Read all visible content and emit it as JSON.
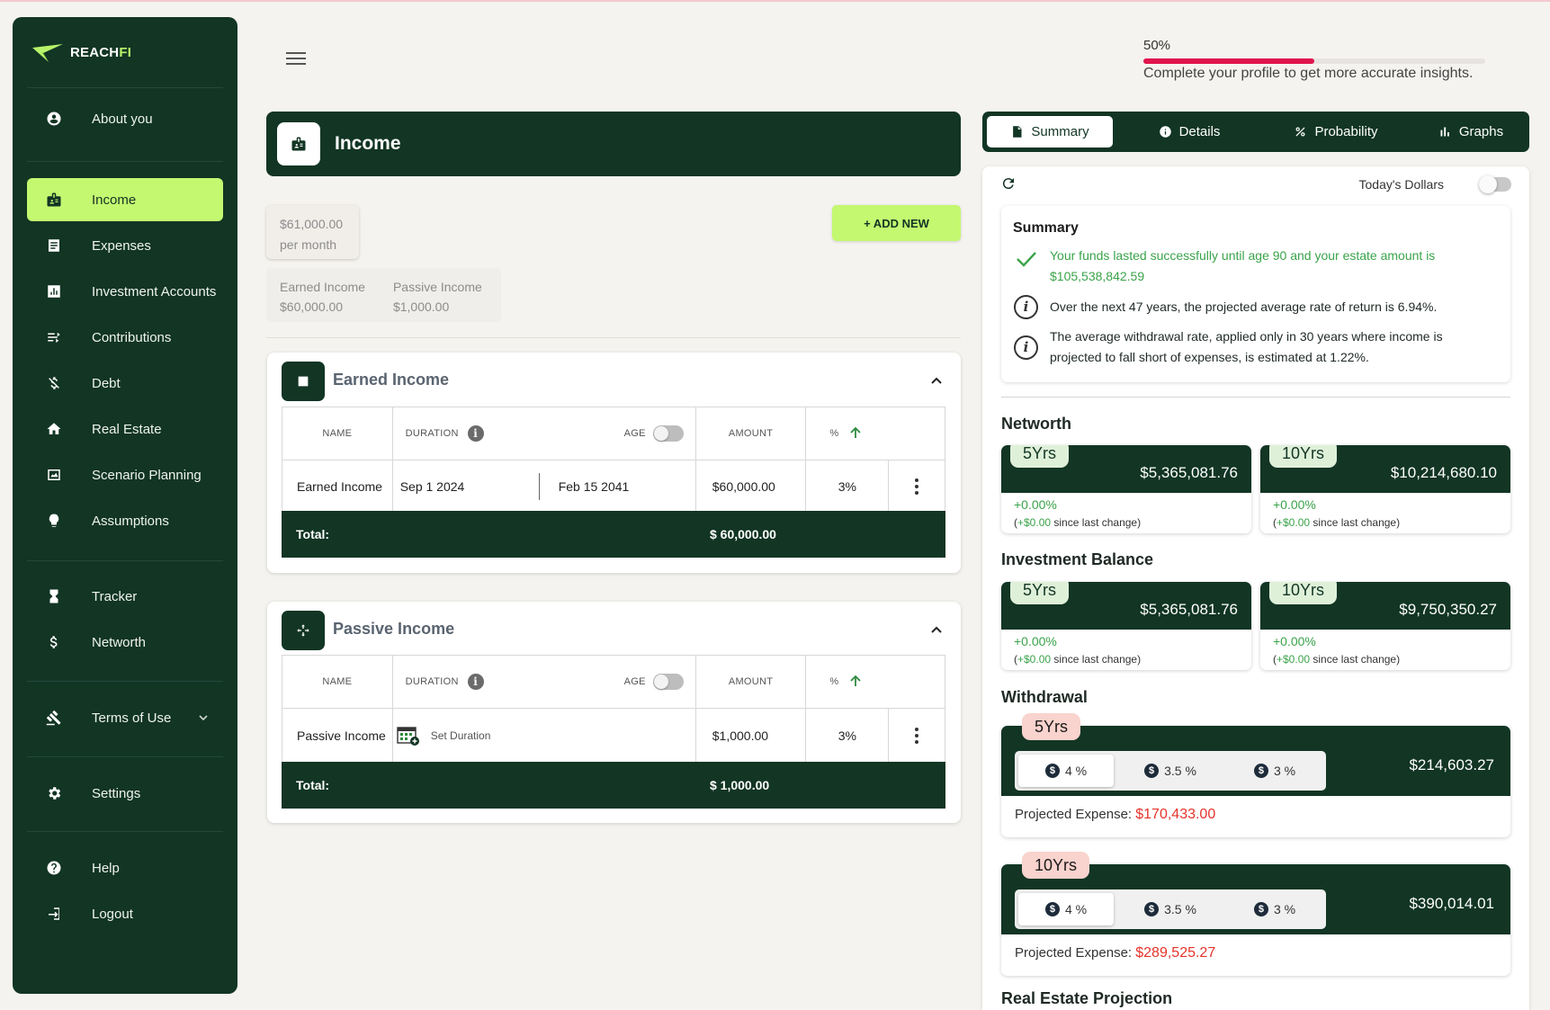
{
  "brand": {
    "name_a": "REACH",
    "name_b": "FI"
  },
  "sidebar": {
    "items": [
      {
        "label": "About you",
        "icon": "account-circle-icon"
      },
      {
        "label": "Income",
        "icon": "income-badge-icon"
      },
      {
        "label": "Expenses",
        "icon": "receipt-icon"
      },
      {
        "label": "Investment Accounts",
        "icon": "bar-chart-icon"
      },
      {
        "label": "Contributions",
        "icon": "flow-icon"
      },
      {
        "label": "Debt",
        "icon": "money-off-icon"
      },
      {
        "label": "Real Estate",
        "icon": "home-icon"
      },
      {
        "label": "Scenario Planning",
        "icon": "scenario-icon"
      },
      {
        "label": "Assumptions",
        "icon": "lightbulb-icon"
      },
      {
        "label": "Tracker",
        "icon": "hourglass-icon"
      },
      {
        "label": "Networth",
        "icon": "dollar-icon"
      },
      {
        "label": "Terms of Use",
        "icon": "gavel-icon"
      },
      {
        "label": "Settings",
        "icon": "gear-icon"
      },
      {
        "label": "Help",
        "icon": "help-icon"
      },
      {
        "label": "Logout",
        "icon": "logout-icon"
      }
    ],
    "active": "Income"
  },
  "profile": {
    "percent_label": "50%",
    "percent": 50,
    "message": "Complete your profile to get more accurate insights."
  },
  "income": {
    "title": "Income",
    "monthly_amount": "$61,000.00",
    "monthly_unit": "per month",
    "add_new_label": "+ ADD NEW",
    "breakdown": [
      {
        "label": "Earned Income",
        "value": "$60,000.00"
      },
      {
        "label": "Passive Income",
        "value": "$1,000.00"
      }
    ],
    "columns": {
      "name": "NAME",
      "duration": "DURATION",
      "age": "AGE",
      "amount": "AMOUNT",
      "percent": "%"
    },
    "earned": {
      "title": "Earned Income",
      "row": {
        "name": "Earned Income",
        "start": "Sep 1 2024",
        "end": "Feb 15 2041",
        "amount_symbol": "$",
        "amount": "60,000.00",
        "percent": "3%"
      },
      "total_label": "Total:",
      "total_value": "$ 60,000.00"
    },
    "passive": {
      "title": "Passive Income",
      "row": {
        "name": "Passive Income",
        "duration": "Set Duration",
        "amount_symbol": "$",
        "amount": "1,000.00",
        "percent": "3%"
      },
      "total_label": "Total:",
      "total_value": "$ 1,000.00"
    }
  },
  "tabs": [
    {
      "label": "Summary",
      "icon": "document-icon"
    },
    {
      "label": "Details",
      "icon": "info-icon"
    },
    {
      "label": "Probability",
      "icon": "percent-icon"
    },
    {
      "label": "Graphs",
      "icon": "graph-icon"
    }
  ],
  "active_tab": "Summary",
  "panel": {
    "todays_dollars": "Today's Dollars",
    "summary": {
      "title": "Summary",
      "success": "Your funds lasted successfully until age 90 and your estate amount is $105,538,842.59",
      "return_rate": "Over the next 47 years, the projected average rate of return is 6.94%.",
      "withdrawal_rate": "The average withdrawal rate, applied only in 30 years where income is projected to fall short of expenses, is estimated at 1.22%."
    },
    "networth": {
      "title": "Networth",
      "cards": [
        {
          "period": "5Yrs",
          "value": "$5,365,081.76",
          "change": "+0.00%",
          "since_amount": "+$0.00",
          "since_text": " since last change)"
        },
        {
          "period": "10Yrs",
          "value": "$10,214,680.10",
          "change": "+0.00%",
          "since_amount": "+$0.00",
          "since_text": " since last change)"
        }
      ]
    },
    "investment": {
      "title": "Investment Balance",
      "cards": [
        {
          "period": "5Yrs",
          "value": "$5,365,081.76",
          "change": "+0.00%",
          "since_amount": "+$0.00",
          "since_text": " since last change)"
        },
        {
          "period": "10Yrs",
          "value": "$9,750,350.27",
          "change": "+0.00%",
          "since_amount": "+$0.00",
          "since_text": " since last change)"
        }
      ]
    },
    "withdrawal": {
      "title": "Withdrawal",
      "rates": [
        "4 %",
        "3.5 %",
        "3 %"
      ],
      "cards": [
        {
          "period": "5Yrs",
          "value": "$214,603.27",
          "expense_label": "Projected Expense: ",
          "expense": "$170,433.00"
        },
        {
          "period": "10Yrs",
          "value": "$390,014.01",
          "expense_label": "Projected Expense: ",
          "expense": "$289,525.27"
        }
      ]
    },
    "real_estate_title": "Real Estate Projection"
  },
  "colors": {
    "primary": "#123524",
    "accent": "#c4f870",
    "progress": "#e0144c",
    "positive": "#3aa34a",
    "negative": "#e5332a"
  }
}
